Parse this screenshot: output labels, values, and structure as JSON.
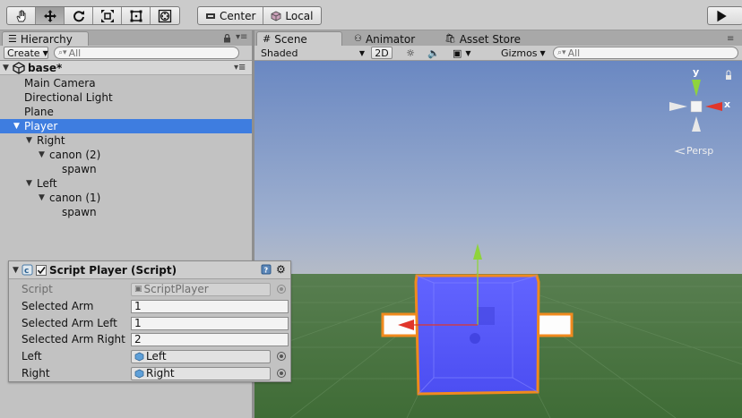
{
  "toolbar": {
    "tools": [
      "hand-tool",
      "move-tool",
      "rotate-tool",
      "scale-tool",
      "rect-tool",
      "transform-tool"
    ],
    "pivot_label": "Center",
    "space_label": "Local",
    "play_icon": "play-icon"
  },
  "hierarchy": {
    "tab_label": "Hierarchy",
    "create_label": "Create",
    "search_placeholder": "All",
    "scene_name": "base*",
    "items": [
      {
        "label": "Main Camera"
      },
      {
        "label": "Directional Light"
      },
      {
        "label": "Plane"
      },
      {
        "label": "Player"
      },
      {
        "label": "Right"
      },
      {
        "label": "canon (2)"
      },
      {
        "label": "spawn"
      },
      {
        "label": "Left"
      },
      {
        "label": "canon (1)"
      },
      {
        "label": "spawn"
      }
    ]
  },
  "scene": {
    "tabs": [
      {
        "label": "Scene"
      },
      {
        "label": "Animator"
      },
      {
        "label": "Asset Store"
      }
    ],
    "shading_label": "Shaded",
    "mode_2d_label": "2D",
    "gizmos_label": "Gizmos",
    "search_placeholder": "All",
    "gizmo": {
      "y_label": "y",
      "x_label": "x",
      "persp_label": "Persp"
    },
    "colors": {
      "sky": "#6f8fc4",
      "ground": "#4a7a43",
      "cube": "#5a5cf7",
      "selection": "#f08a1e"
    }
  },
  "inspector": {
    "component_title": "Script Player (Script)",
    "fields": [
      {
        "label": "Script",
        "value": "ScriptPlayer"
      },
      {
        "label": "Selected Arm",
        "value": "1"
      },
      {
        "label": "Selected Arm Left",
        "value": "1"
      },
      {
        "label": "Selected Arm Right",
        "value": "2"
      },
      {
        "label": "Left",
        "value": "Left"
      },
      {
        "label": "Right",
        "value": "Right"
      }
    ]
  }
}
